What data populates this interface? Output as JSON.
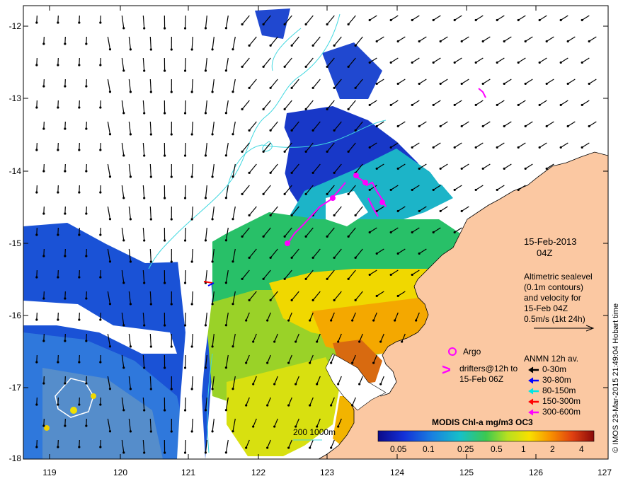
{
  "map": {
    "date": "15-Feb-2013",
    "time": "04Z",
    "altimetry": [
      "Altimetric sealevel",
      "(0.1m contours)",
      "and velocity for",
      "15-Feb 04Z",
      "0.5m/s (1kt 24h)"
    ],
    "argo_label": "Argo",
    "drifters": [
      "drifters@12h to",
      "15-Feb 06Z"
    ],
    "anmn": {
      "title": "ANMN 12h av.",
      "entries": [
        {
          "label": "0-30m",
          "color": "#000000"
        },
        {
          "label": "30-80m",
          "color": "#0000ff"
        },
        {
          "label": "80-150m",
          "color": "#00e5e5"
        },
        {
          "label": "150-300m",
          "color": "#ff0000"
        },
        {
          "label": "300-600m",
          "color": "#ff00ff"
        }
      ]
    },
    "depth_contours": "200  1000m",
    "colorbar_title": "MODIS Chl-a mg/m3 OC3",
    "colorbar_ticks": [
      "0.05",
      "0.1",
      "0.25",
      "0.5",
      "1",
      "2",
      "4"
    ],
    "credit": "© IMOS 23-Mar-2015 21:49:04 Hobart time",
    "lat_labels": [
      "-12",
      "-13",
      "-14",
      "-15",
      "-16",
      "-17",
      "-18"
    ],
    "lon_labels": [
      "119",
      "120",
      "121",
      "122",
      "123",
      "124",
      "125",
      "126",
      "127"
    ],
    "colors": {
      "land": "#fbc8a2",
      "cloud": "#ffffff",
      "contour": "#40d8e0",
      "drifter": "#ff00ff"
    }
  }
}
